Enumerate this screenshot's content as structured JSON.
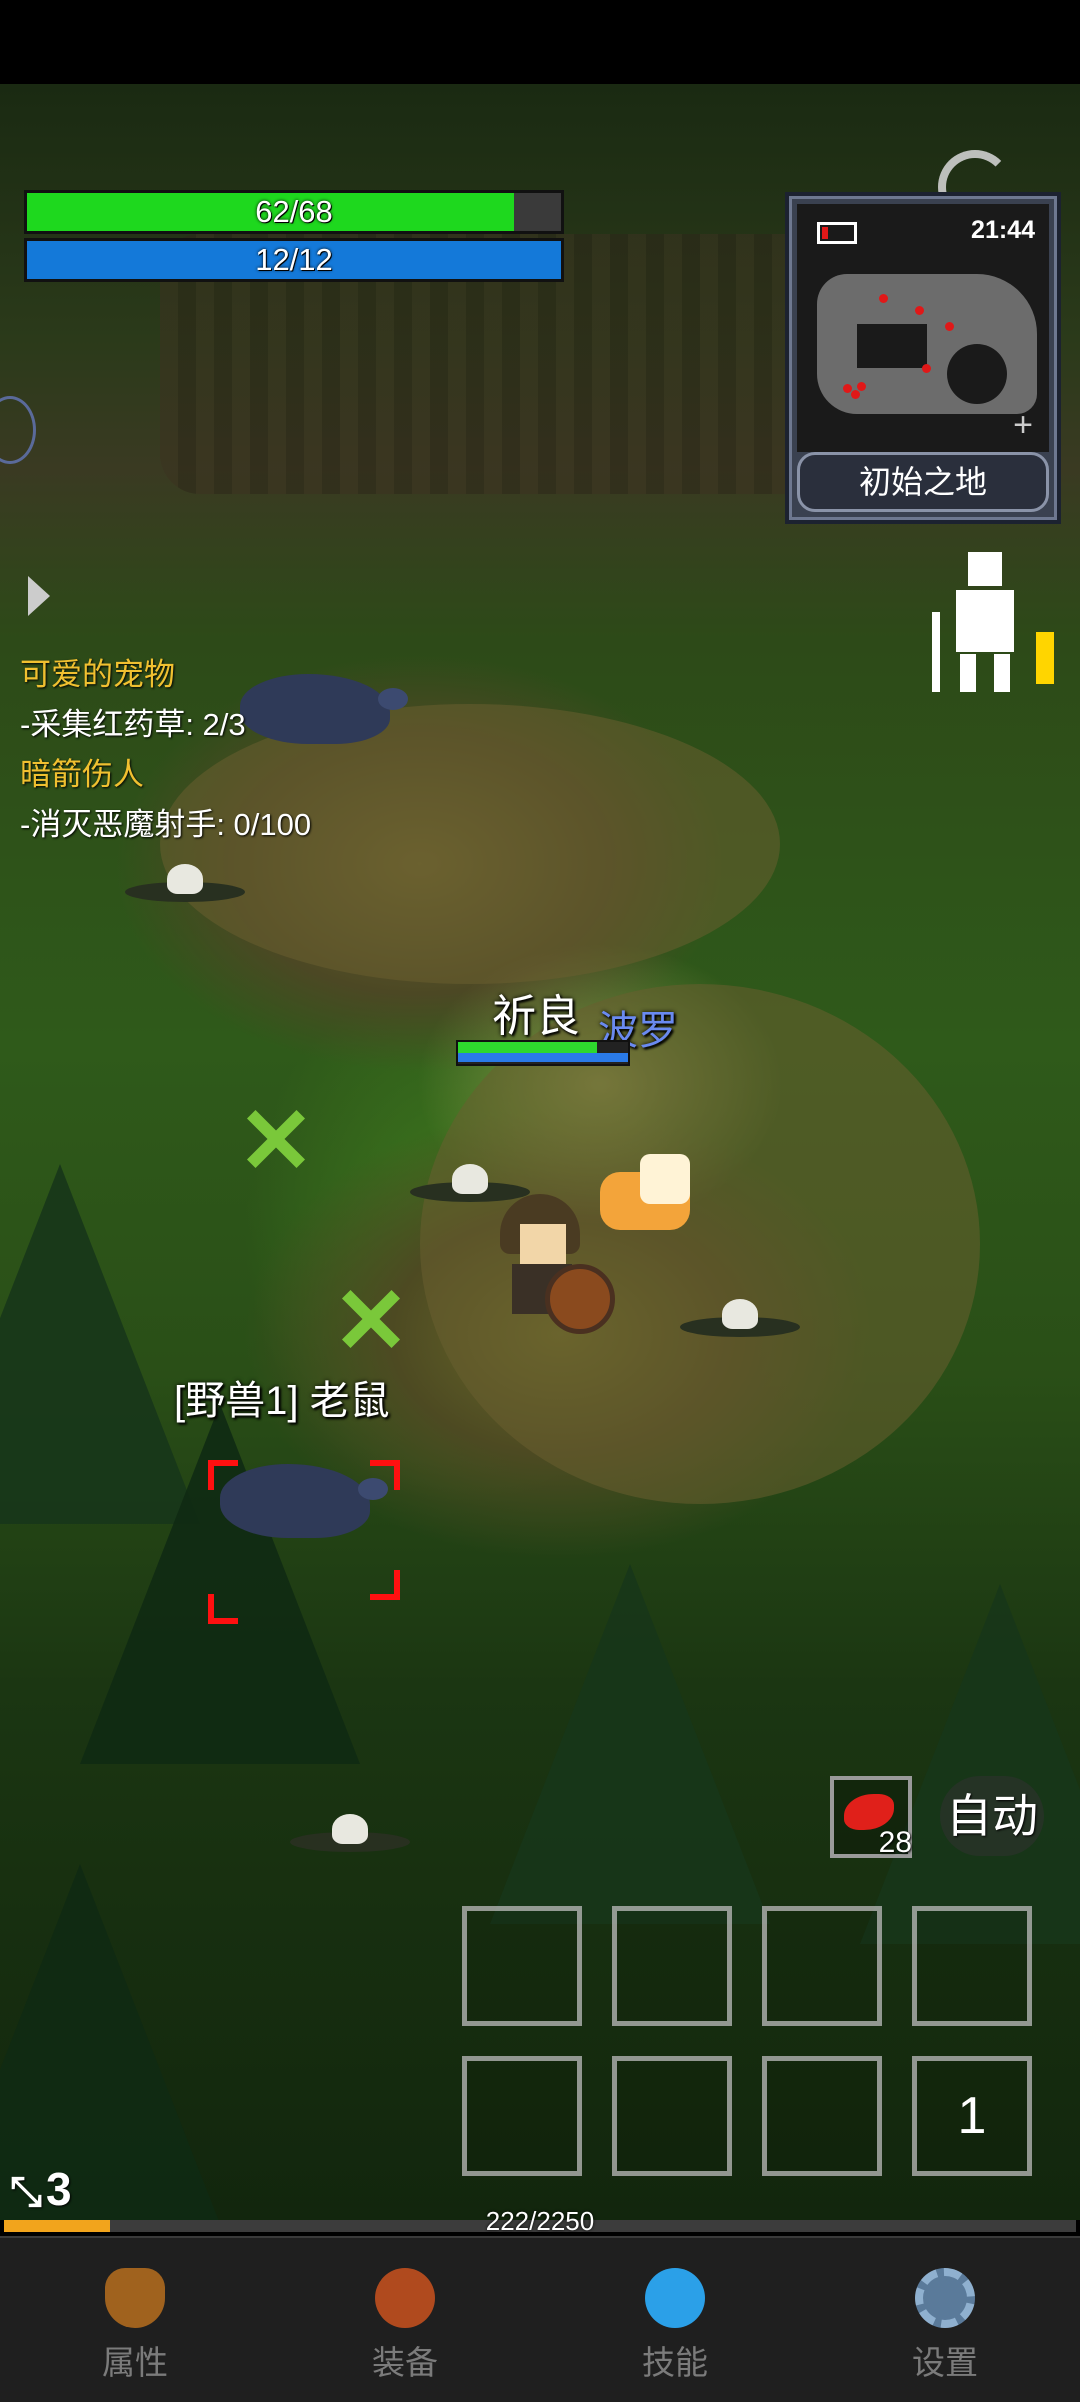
{
  "hud": {
    "hp": {
      "text": "62/68",
      "fraction": 0.912
    },
    "mp": {
      "text": "12/12",
      "fraction": 1.0
    }
  },
  "minimap": {
    "time": "21:44",
    "location": "初始之地"
  },
  "quests": [
    {
      "title": "可爱的宠物",
      "task": "-采集红药草: 2/3"
    },
    {
      "title": "暗箭伤人",
      "task": "-消灭恶魔射手: 0/100"
    }
  ],
  "player": {
    "name": "祈良",
    "hp_fraction": 0.82,
    "mp_fraction": 1.0
  },
  "pet": {
    "name": "波罗"
  },
  "enemy": {
    "label": "[野兽1] 老鼠"
  },
  "actions": {
    "potion_count": "28",
    "auto_label": "自动",
    "skill_slot_label": "1"
  },
  "attack_level": "3",
  "xp": {
    "text": "222/2250",
    "fraction": 0.0987
  },
  "nav": [
    {
      "label": "属性",
      "icon": "helmet-icon"
    },
    {
      "label": "装备",
      "icon": "bag-icon"
    },
    {
      "label": "技能",
      "icon": "gem-icon"
    },
    {
      "label": "设置",
      "icon": "gear-icon"
    }
  ],
  "colors": {
    "hp": "#1ed81e",
    "mp": "#1479d9",
    "quest_title": "#f0c030",
    "pet_name": "#6a8af0",
    "xp": "#f2a41c"
  }
}
